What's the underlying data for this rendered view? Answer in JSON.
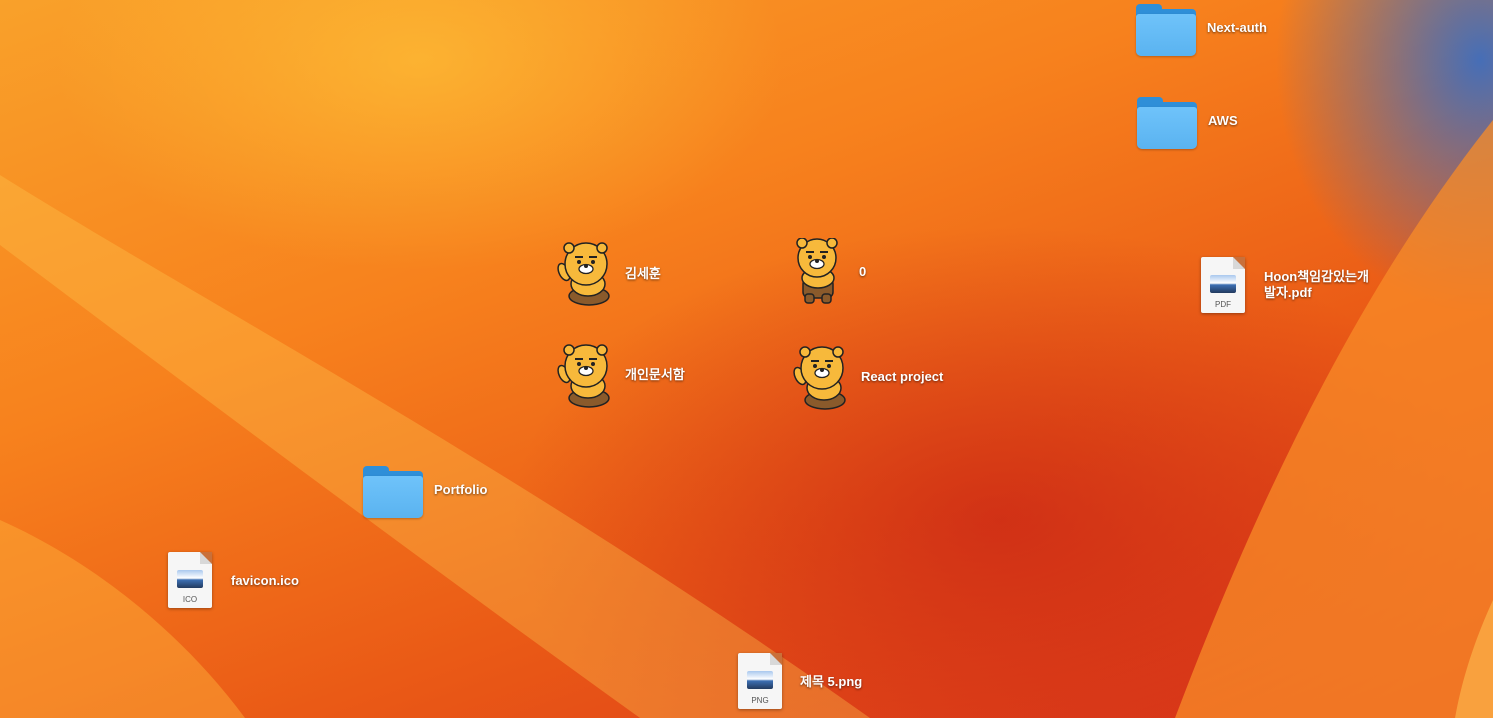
{
  "desktop": {
    "items": [
      {
        "label": "Next-auth",
        "kind": "folder"
      },
      {
        "label": "AWS",
        "kind": "folder"
      },
      {
        "label": "Hoon책임감있는개발자.pdf",
        "kind": "document",
        "ext": "PDF"
      },
      {
        "label": "김세훈",
        "kind": "character-icon"
      },
      {
        "label": "0",
        "kind": "character-icon"
      },
      {
        "label": "개인문서함",
        "kind": "character-icon"
      },
      {
        "label": "React project",
        "kind": "character-icon"
      },
      {
        "label": "Portfolio",
        "kind": "folder"
      },
      {
        "label": "favicon.ico",
        "kind": "document",
        "ext": "ICO"
      },
      {
        "label": "제목 5.png",
        "kind": "document",
        "ext": "PNG"
      }
    ]
  },
  "colors": {
    "folder_front": "#5ab3f0",
    "folder_back": "#2f8fd8",
    "character_body": "#f7b93b",
    "character_pants": "#8a5a2b"
  }
}
